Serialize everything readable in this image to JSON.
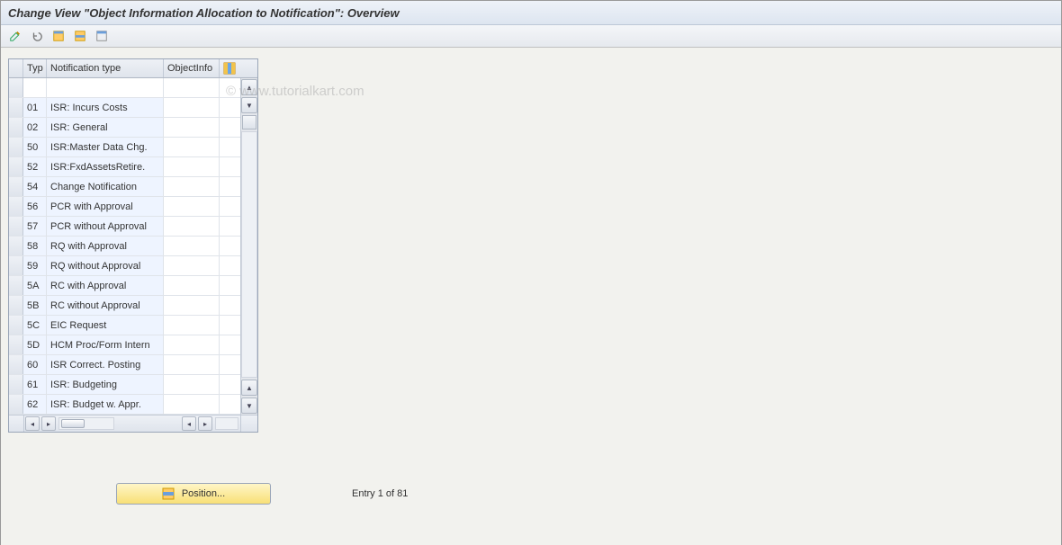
{
  "title": "Change View \"Object Information Allocation to Notification\": Overview",
  "watermark": "© www.tutorialkart.com",
  "toolbar": {
    "edit": "edit",
    "undo": "undo",
    "select_all": "select-all",
    "deselect": "deselect",
    "delete": "delete"
  },
  "columns": {
    "sel": "",
    "typ": "Typ",
    "ntype": "Notification type",
    "obj": "ObjectInfo",
    "config": "config"
  },
  "rows": [
    {
      "typ": "",
      "ntype": "",
      "obj": ""
    },
    {
      "typ": "01",
      "ntype": "ISR: Incurs Costs",
      "obj": ""
    },
    {
      "typ": "02",
      "ntype": "ISR: General",
      "obj": ""
    },
    {
      "typ": "50",
      "ntype": "ISR:Master Data Chg.",
      "obj": ""
    },
    {
      "typ": "52",
      "ntype": "ISR:FxdAssetsRetire.",
      "obj": ""
    },
    {
      "typ": "54",
      "ntype": "Change Notification",
      "obj": ""
    },
    {
      "typ": "56",
      "ntype": "PCR with Approval",
      "obj": ""
    },
    {
      "typ": "57",
      "ntype": "PCR without Approval",
      "obj": ""
    },
    {
      "typ": "58",
      "ntype": "RQ with Approval",
      "obj": ""
    },
    {
      "typ": "59",
      "ntype": "RQ without Approval",
      "obj": ""
    },
    {
      "typ": "5A",
      "ntype": "RC with Approval",
      "obj": ""
    },
    {
      "typ": "5B",
      "ntype": "RC without Approval",
      "obj": ""
    },
    {
      "typ": "5C",
      "ntype": "EIC Request",
      "obj": ""
    },
    {
      "typ": "5D",
      "ntype": "HCM Proc/Form Intern",
      "obj": ""
    },
    {
      "typ": "60",
      "ntype": "ISR Correct. Posting",
      "obj": ""
    },
    {
      "typ": "61",
      "ntype": "ISR: Budgeting",
      "obj": ""
    },
    {
      "typ": "62",
      "ntype": "ISR: Budget w. Appr.",
      "obj": ""
    }
  ],
  "position_button": "Position...",
  "entry_status": "Entry 1 of 81"
}
